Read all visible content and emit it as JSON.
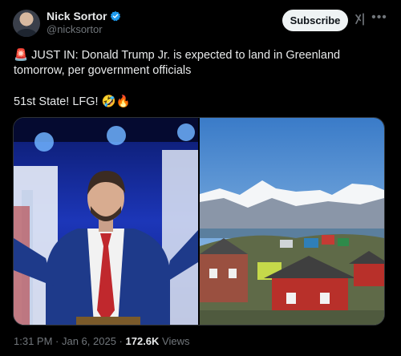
{
  "author": {
    "name": "Nick Sortor",
    "handle": "@nicksortor",
    "verified": true
  },
  "header": {
    "subscribe_label": "Subscribe",
    "grok_icon": "grok-icon",
    "more_icon": "more-icon"
  },
  "tweet": {
    "line1_emoji": "🚨",
    "line1_text": " JUST IN: Donald Trump Jr. is expected to land in Greenland tomorrow, per  government officials",
    "line2_text": "51st State! LFG! 🤣🔥"
  },
  "media": [
    {
      "name": "photo-trump-jr"
    },
    {
      "name": "photo-greenland-town"
    }
  ],
  "footer": {
    "time": "1:31 PM",
    "sep1": " · ",
    "date": "Jan 6, 2025",
    "sep2": " · ",
    "views_count": "172.6K",
    "views_label": " Views"
  },
  "colors": {
    "background": "#000000",
    "verified": "#1d9bf0",
    "muted": "#71767b",
    "text": "#e7e9ea"
  }
}
